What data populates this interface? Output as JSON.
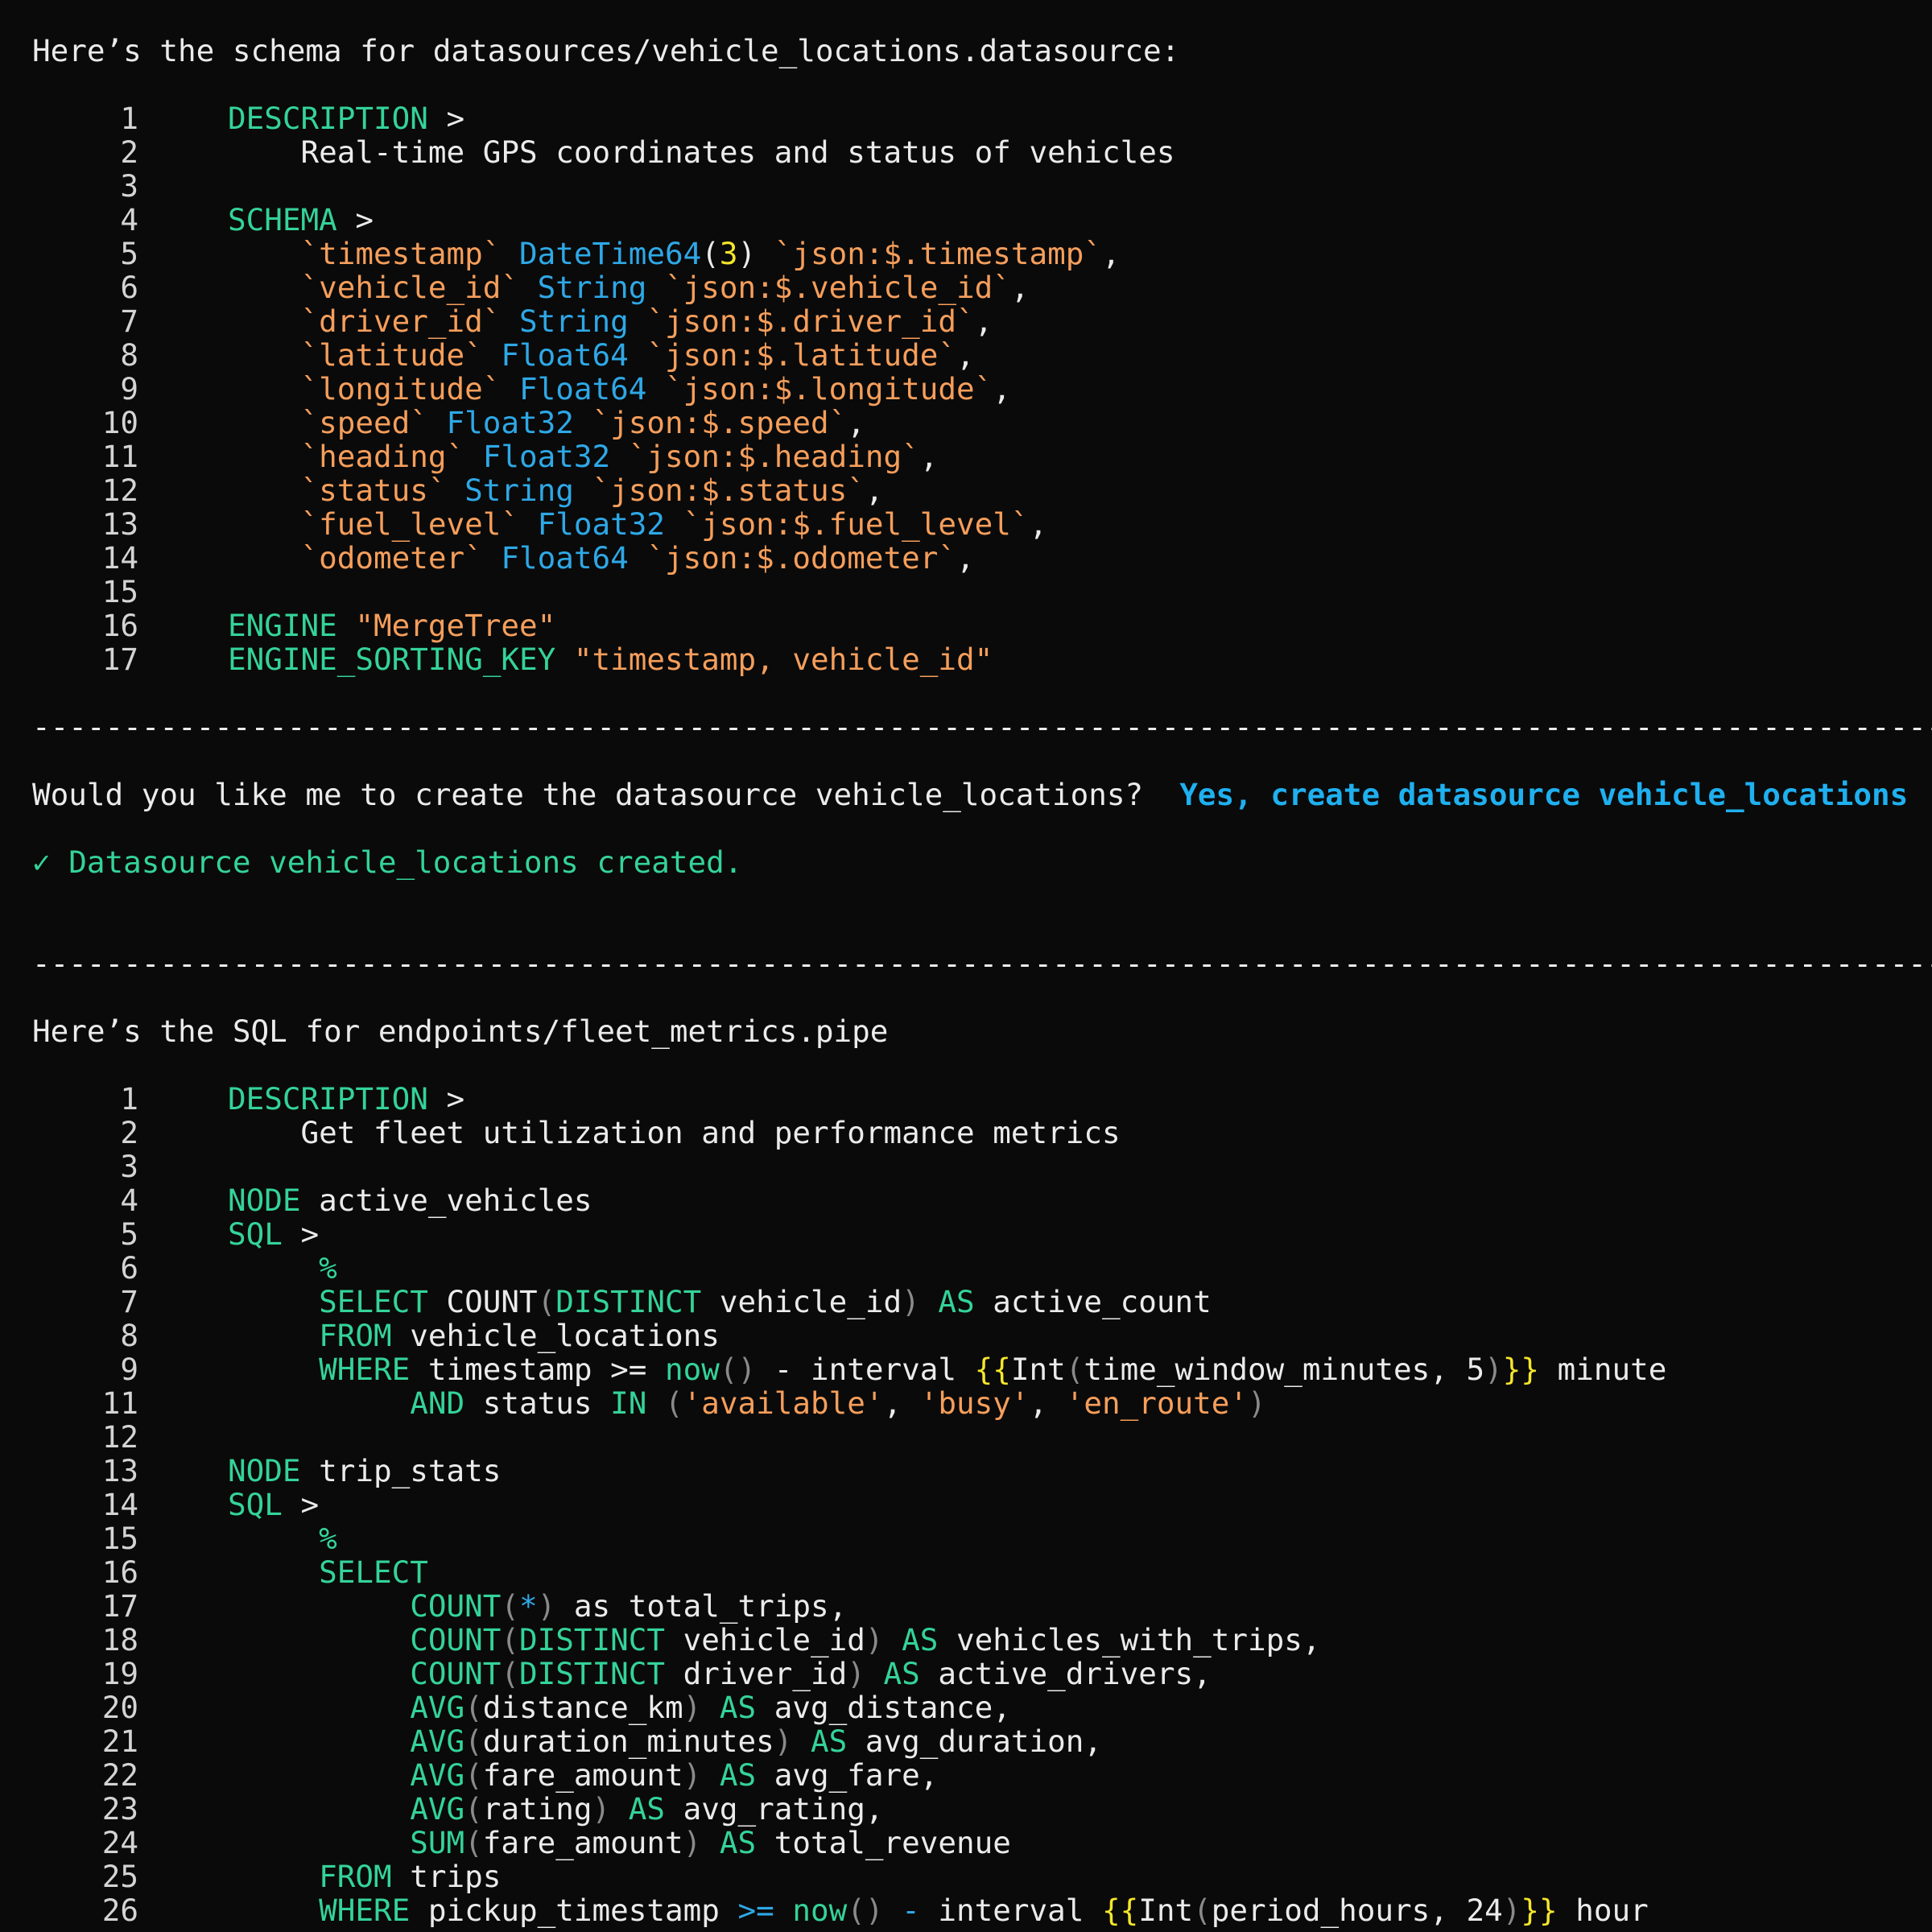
{
  "header1": "Here’s the schema for datasources/vehicle_locations.datasource:",
  "schema_lines": [
    {
      "n": "1",
      "t": [
        [
          "kw",
          "DESCRIPTION"
        ],
        [
          "plain",
          " >"
        ]
      ]
    },
    {
      "n": "2",
      "t": [
        [
          "plain",
          "    Real-time GPS coordinates and status of vehicles"
        ]
      ]
    },
    {
      "n": "3",
      "t": []
    },
    {
      "n": "4",
      "t": [
        [
          "kw",
          "SCHEMA"
        ],
        [
          "plain",
          " >"
        ]
      ]
    },
    {
      "n": "5",
      "t": [
        [
          "plain",
          "    "
        ],
        [
          "str",
          "`timestamp`"
        ],
        [
          "plain",
          " "
        ],
        [
          "type",
          "DateTime64"
        ],
        [
          "plain",
          "("
        ],
        [
          "num",
          "3"
        ],
        [
          "plain",
          ") "
        ],
        [
          "str",
          "`json:$.timestamp`"
        ],
        [
          "plain",
          ","
        ]
      ]
    },
    {
      "n": "6",
      "t": [
        [
          "plain",
          "    "
        ],
        [
          "str",
          "`vehicle_id`"
        ],
        [
          "plain",
          " "
        ],
        [
          "type",
          "String"
        ],
        [
          "plain",
          " "
        ],
        [
          "str",
          "`json:$.vehicle_id`"
        ],
        [
          "plain",
          ","
        ]
      ]
    },
    {
      "n": "7",
      "t": [
        [
          "plain",
          "    "
        ],
        [
          "str",
          "`driver_id`"
        ],
        [
          "plain",
          " "
        ],
        [
          "type",
          "String"
        ],
        [
          "plain",
          " "
        ],
        [
          "str",
          "`json:$.driver_id`"
        ],
        [
          "plain",
          ","
        ]
      ]
    },
    {
      "n": "8",
      "t": [
        [
          "plain",
          "    "
        ],
        [
          "str",
          "`latitude`"
        ],
        [
          "plain",
          " "
        ],
        [
          "type",
          "Float64"
        ],
        [
          "plain",
          " "
        ],
        [
          "str",
          "`json:$.latitude`"
        ],
        [
          "plain",
          ","
        ]
      ]
    },
    {
      "n": "9",
      "t": [
        [
          "plain",
          "    "
        ],
        [
          "str",
          "`longitude`"
        ],
        [
          "plain",
          " "
        ],
        [
          "type",
          "Float64"
        ],
        [
          "plain",
          " "
        ],
        [
          "str",
          "`json:$.longitude`"
        ],
        [
          "plain",
          ","
        ]
      ]
    },
    {
      "n": "10",
      "t": [
        [
          "plain",
          "    "
        ],
        [
          "str",
          "`speed`"
        ],
        [
          "plain",
          " "
        ],
        [
          "type",
          "Float32"
        ],
        [
          "plain",
          " "
        ],
        [
          "str",
          "`json:$.speed`"
        ],
        [
          "plain",
          ","
        ]
      ]
    },
    {
      "n": "11",
      "t": [
        [
          "plain",
          "    "
        ],
        [
          "str",
          "`heading`"
        ],
        [
          "plain",
          " "
        ],
        [
          "type",
          "Float32"
        ],
        [
          "plain",
          " "
        ],
        [
          "str",
          "`json:$.heading`"
        ],
        [
          "plain",
          ","
        ]
      ]
    },
    {
      "n": "12",
      "t": [
        [
          "plain",
          "    "
        ],
        [
          "str",
          "`status`"
        ],
        [
          "plain",
          " "
        ],
        [
          "type",
          "String"
        ],
        [
          "plain",
          " "
        ],
        [
          "str",
          "`json:$.status`"
        ],
        [
          "plain",
          ","
        ]
      ]
    },
    {
      "n": "13",
      "t": [
        [
          "plain",
          "    "
        ],
        [
          "str",
          "`fuel_level`"
        ],
        [
          "plain",
          " "
        ],
        [
          "type",
          "Float32"
        ],
        [
          "plain",
          " "
        ],
        [
          "str",
          "`json:$.fuel_level`"
        ],
        [
          "plain",
          ","
        ]
      ]
    },
    {
      "n": "14",
      "t": [
        [
          "plain",
          "    "
        ],
        [
          "str",
          "`odometer`"
        ],
        [
          "plain",
          " "
        ],
        [
          "type",
          "Float64"
        ],
        [
          "plain",
          " "
        ],
        [
          "str",
          "`json:$.odometer`"
        ],
        [
          "plain",
          ","
        ]
      ]
    },
    {
      "n": "15",
      "t": []
    },
    {
      "n": "16",
      "t": [
        [
          "kw",
          "ENGINE"
        ],
        [
          "plain",
          " "
        ],
        [
          "str",
          "\"MergeTree\""
        ]
      ]
    },
    {
      "n": "17",
      "t": [
        [
          "kw",
          "ENGINE_SORTING_KEY"
        ],
        [
          "plain",
          " "
        ],
        [
          "str",
          "\"timestamp, vehicle_id\""
        ]
      ]
    }
  ],
  "divider": "-----------------------------------------------------------------------------------------------------------",
  "prompt": {
    "question": "Would you like me to create the datasource vehicle_locations?",
    "action": "Yes, create datasource vehicle_locations"
  },
  "success": {
    "check": "✓",
    "message": "Datasource vehicle_locations created."
  },
  "header2": "Here’s the SQL for endpoints/fleet_metrics.pipe",
  "pipe_lines": [
    {
      "n": "1",
      "t": [
        [
          "kw",
          "DESCRIPTION"
        ],
        [
          "plain",
          " >"
        ]
      ]
    },
    {
      "n": "2",
      "t": [
        [
          "plain",
          "    Get fleet utilization and performance metrics"
        ]
      ]
    },
    {
      "n": "3",
      "t": []
    },
    {
      "n": "4",
      "t": [
        [
          "kw",
          "NODE"
        ],
        [
          "plain",
          " active_vehicles"
        ]
      ]
    },
    {
      "n": "5",
      "t": [
        [
          "kw",
          "SQL"
        ],
        [
          "plain",
          " >"
        ]
      ]
    },
    {
      "n": "6",
      "t": [
        [
          "plain",
          "     "
        ],
        [
          "kw",
          "%"
        ]
      ]
    },
    {
      "n": "7",
      "t": [
        [
          "plain",
          "     "
        ],
        [
          "kw",
          "SELECT"
        ],
        [
          "plain",
          " COUNT"
        ],
        [
          "paren",
          "("
        ],
        [
          "kw",
          "DISTINCT"
        ],
        [
          "plain",
          " vehicle_id"
        ],
        [
          "paren",
          ")"
        ],
        [
          "plain",
          " "
        ],
        [
          "kw",
          "AS"
        ],
        [
          "plain",
          " active_count"
        ]
      ]
    },
    {
      "n": "8",
      "t": [
        [
          "plain",
          "     "
        ],
        [
          "kw",
          "FROM"
        ],
        [
          "plain",
          " vehicle_locations"
        ]
      ]
    },
    {
      "n": "9",
      "t": [
        [
          "plain",
          "     "
        ],
        [
          "kw",
          "WHERE"
        ],
        [
          "plain",
          " timestamp >= "
        ],
        [
          "kw",
          "now"
        ],
        [
          "paren",
          "()"
        ],
        [
          "plain",
          " - interval "
        ],
        [
          "brace",
          "{{"
        ],
        [
          "plain",
          "Int"
        ],
        [
          "paren",
          "("
        ],
        [
          "plain",
          "time_window_minutes, 5"
        ],
        [
          "paren",
          ")"
        ],
        [
          "brace",
          "}}"
        ],
        [
          "plain",
          " minute"
        ]
      ]
    },
    {
      "n": "11",
      "t": [
        [
          "plain",
          "          "
        ],
        [
          "kw",
          "AND"
        ],
        [
          "plain",
          " status "
        ],
        [
          "kw",
          "IN"
        ],
        [
          "plain",
          " "
        ],
        [
          "paren",
          "("
        ],
        [
          "str",
          "'available'"
        ],
        [
          "plain",
          ", "
        ],
        [
          "str",
          "'busy'"
        ],
        [
          "plain",
          ", "
        ],
        [
          "str",
          "'en_route'"
        ],
        [
          "paren",
          ")"
        ]
      ]
    },
    {
      "n": "12",
      "t": []
    },
    {
      "n": "13",
      "t": [
        [
          "kw",
          "NODE"
        ],
        [
          "plain",
          " trip_stats"
        ]
      ]
    },
    {
      "n": "14",
      "t": [
        [
          "kw",
          "SQL"
        ],
        [
          "plain",
          " >"
        ]
      ]
    },
    {
      "n": "15",
      "t": [
        [
          "plain",
          "     "
        ],
        [
          "kw",
          "%"
        ]
      ]
    },
    {
      "n": "16",
      "t": [
        [
          "plain",
          "     "
        ],
        [
          "kw",
          "SELECT"
        ]
      ]
    },
    {
      "n": "17",
      "t": [
        [
          "plain",
          "          "
        ],
        [
          "kw",
          "COUNT"
        ],
        [
          "paren",
          "("
        ],
        [
          "op",
          "*"
        ],
        [
          "paren",
          ")"
        ],
        [
          "plain",
          " as total_trips,"
        ]
      ]
    },
    {
      "n": "18",
      "t": [
        [
          "plain",
          "          "
        ],
        [
          "kw",
          "COUNT"
        ],
        [
          "paren",
          "("
        ],
        [
          "kw",
          "DISTINCT"
        ],
        [
          "plain",
          " vehicle_id"
        ],
        [
          "paren",
          ")"
        ],
        [
          "plain",
          " "
        ],
        [
          "kw",
          "AS"
        ],
        [
          "plain",
          " vehicles_with_trips,"
        ]
      ]
    },
    {
      "n": "19",
      "t": [
        [
          "plain",
          "          "
        ],
        [
          "kw",
          "COUNT"
        ],
        [
          "paren",
          "("
        ],
        [
          "kw",
          "DISTINCT"
        ],
        [
          "plain",
          " driver_id"
        ],
        [
          "paren",
          ")"
        ],
        [
          "plain",
          " "
        ],
        [
          "kw",
          "AS"
        ],
        [
          "plain",
          " active_drivers,"
        ]
      ]
    },
    {
      "n": "20",
      "t": [
        [
          "plain",
          "          "
        ],
        [
          "kw",
          "AVG"
        ],
        [
          "paren",
          "("
        ],
        [
          "plain",
          "distance_km"
        ],
        [
          "paren",
          ")"
        ],
        [
          "plain",
          " "
        ],
        [
          "kw",
          "AS"
        ],
        [
          "plain",
          " avg_distance,"
        ]
      ]
    },
    {
      "n": "21",
      "t": [
        [
          "plain",
          "          "
        ],
        [
          "kw",
          "AVG"
        ],
        [
          "paren",
          "("
        ],
        [
          "plain",
          "duration_minutes"
        ],
        [
          "paren",
          ")"
        ],
        [
          "plain",
          " "
        ],
        [
          "kw",
          "AS"
        ],
        [
          "plain",
          " avg_duration,"
        ]
      ]
    },
    {
      "n": "22",
      "t": [
        [
          "plain",
          "          "
        ],
        [
          "kw",
          "AVG"
        ],
        [
          "paren",
          "("
        ],
        [
          "plain",
          "fare_amount"
        ],
        [
          "paren",
          ")"
        ],
        [
          "plain",
          " "
        ],
        [
          "kw",
          "AS"
        ],
        [
          "plain",
          " avg_fare,"
        ]
      ]
    },
    {
      "n": "23",
      "t": [
        [
          "plain",
          "          "
        ],
        [
          "kw",
          "AVG"
        ],
        [
          "paren",
          "("
        ],
        [
          "plain",
          "rating"
        ],
        [
          "paren",
          ")"
        ],
        [
          "plain",
          " "
        ],
        [
          "kw",
          "AS"
        ],
        [
          "plain",
          " avg_rating,"
        ]
      ]
    },
    {
      "n": "24",
      "t": [
        [
          "plain",
          "          "
        ],
        [
          "kw",
          "SUM"
        ],
        [
          "paren",
          "("
        ],
        [
          "plain",
          "fare_amount"
        ],
        [
          "paren",
          ")"
        ],
        [
          "plain",
          " "
        ],
        [
          "kw",
          "AS"
        ],
        [
          "plain",
          " total_revenue"
        ]
      ]
    },
    {
      "n": "25",
      "t": [
        [
          "plain",
          "     "
        ],
        [
          "kw",
          "FROM"
        ],
        [
          "plain",
          " trips"
        ]
      ]
    },
    {
      "n": "26",
      "t": [
        [
          "plain",
          "     "
        ],
        [
          "kw",
          "WHERE"
        ],
        [
          "plain",
          " pickup_timestamp "
        ],
        [
          "op",
          ">="
        ],
        [
          "plain",
          " "
        ],
        [
          "kw",
          "now"
        ],
        [
          "paren",
          "()"
        ],
        [
          "plain",
          " "
        ],
        [
          "op",
          "-"
        ],
        [
          "plain",
          " interval "
        ],
        [
          "brace",
          "{{"
        ],
        [
          "plain",
          "Int"
        ],
        [
          "paren",
          "("
        ],
        [
          "plain",
          "period_hours, 24"
        ],
        [
          "paren",
          ")"
        ],
        [
          "brace",
          "}}"
        ],
        [
          "plain",
          " hour"
        ]
      ]
    }
  ],
  "colors": {
    "background": "#0a0a0a",
    "keyword": "#34d399",
    "string": "#f59e5b",
    "type": "#2ea8e6",
    "number": "#f5e62b",
    "action": "#1fb0ef"
  }
}
